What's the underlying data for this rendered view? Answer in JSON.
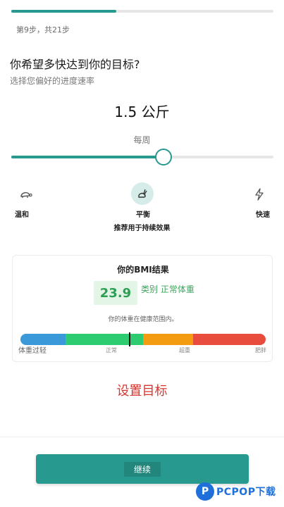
{
  "progress": {
    "step_text": "第9步，共21步",
    "fraction": 0.4
  },
  "question": {
    "title": "你希望多快达到你的目标?",
    "subtitle": "选择您偏好的进度速率"
  },
  "rate": {
    "value_text": "1.5 公斤",
    "period_label": "每周",
    "slider_fraction": 0.58
  },
  "speed_options": [
    {
      "label": "温和",
      "icon": "turtle-icon",
      "selected": false
    },
    {
      "label": "平衡",
      "icon": "rabbit-icon",
      "selected": true
    },
    {
      "label": "快速",
      "icon": "lightning-icon",
      "selected": false
    }
  ],
  "recommend_note": "推荐用于持续效果",
  "bmi": {
    "title": "你的BMI结果",
    "value": "23.9",
    "category": "类别 正常体重",
    "note": "你的体重在健康范围内。",
    "scale_labels": [
      "体重过轻",
      "正常",
      "超重",
      "肥胖"
    ],
    "marker_fraction": 0.446,
    "segment_colors": [
      "#3a9ad9",
      "#2ecc71",
      "#f39c12",
      "#e74c3c"
    ]
  },
  "set_goal_label": "设置目标",
  "continue_label": "继续",
  "watermark": {
    "logo_letter": "P",
    "text": "PCPOP下载"
  },
  "colors": {
    "accent": "#27998e",
    "danger": "#d9352f",
    "success": "#2e9e54"
  }
}
